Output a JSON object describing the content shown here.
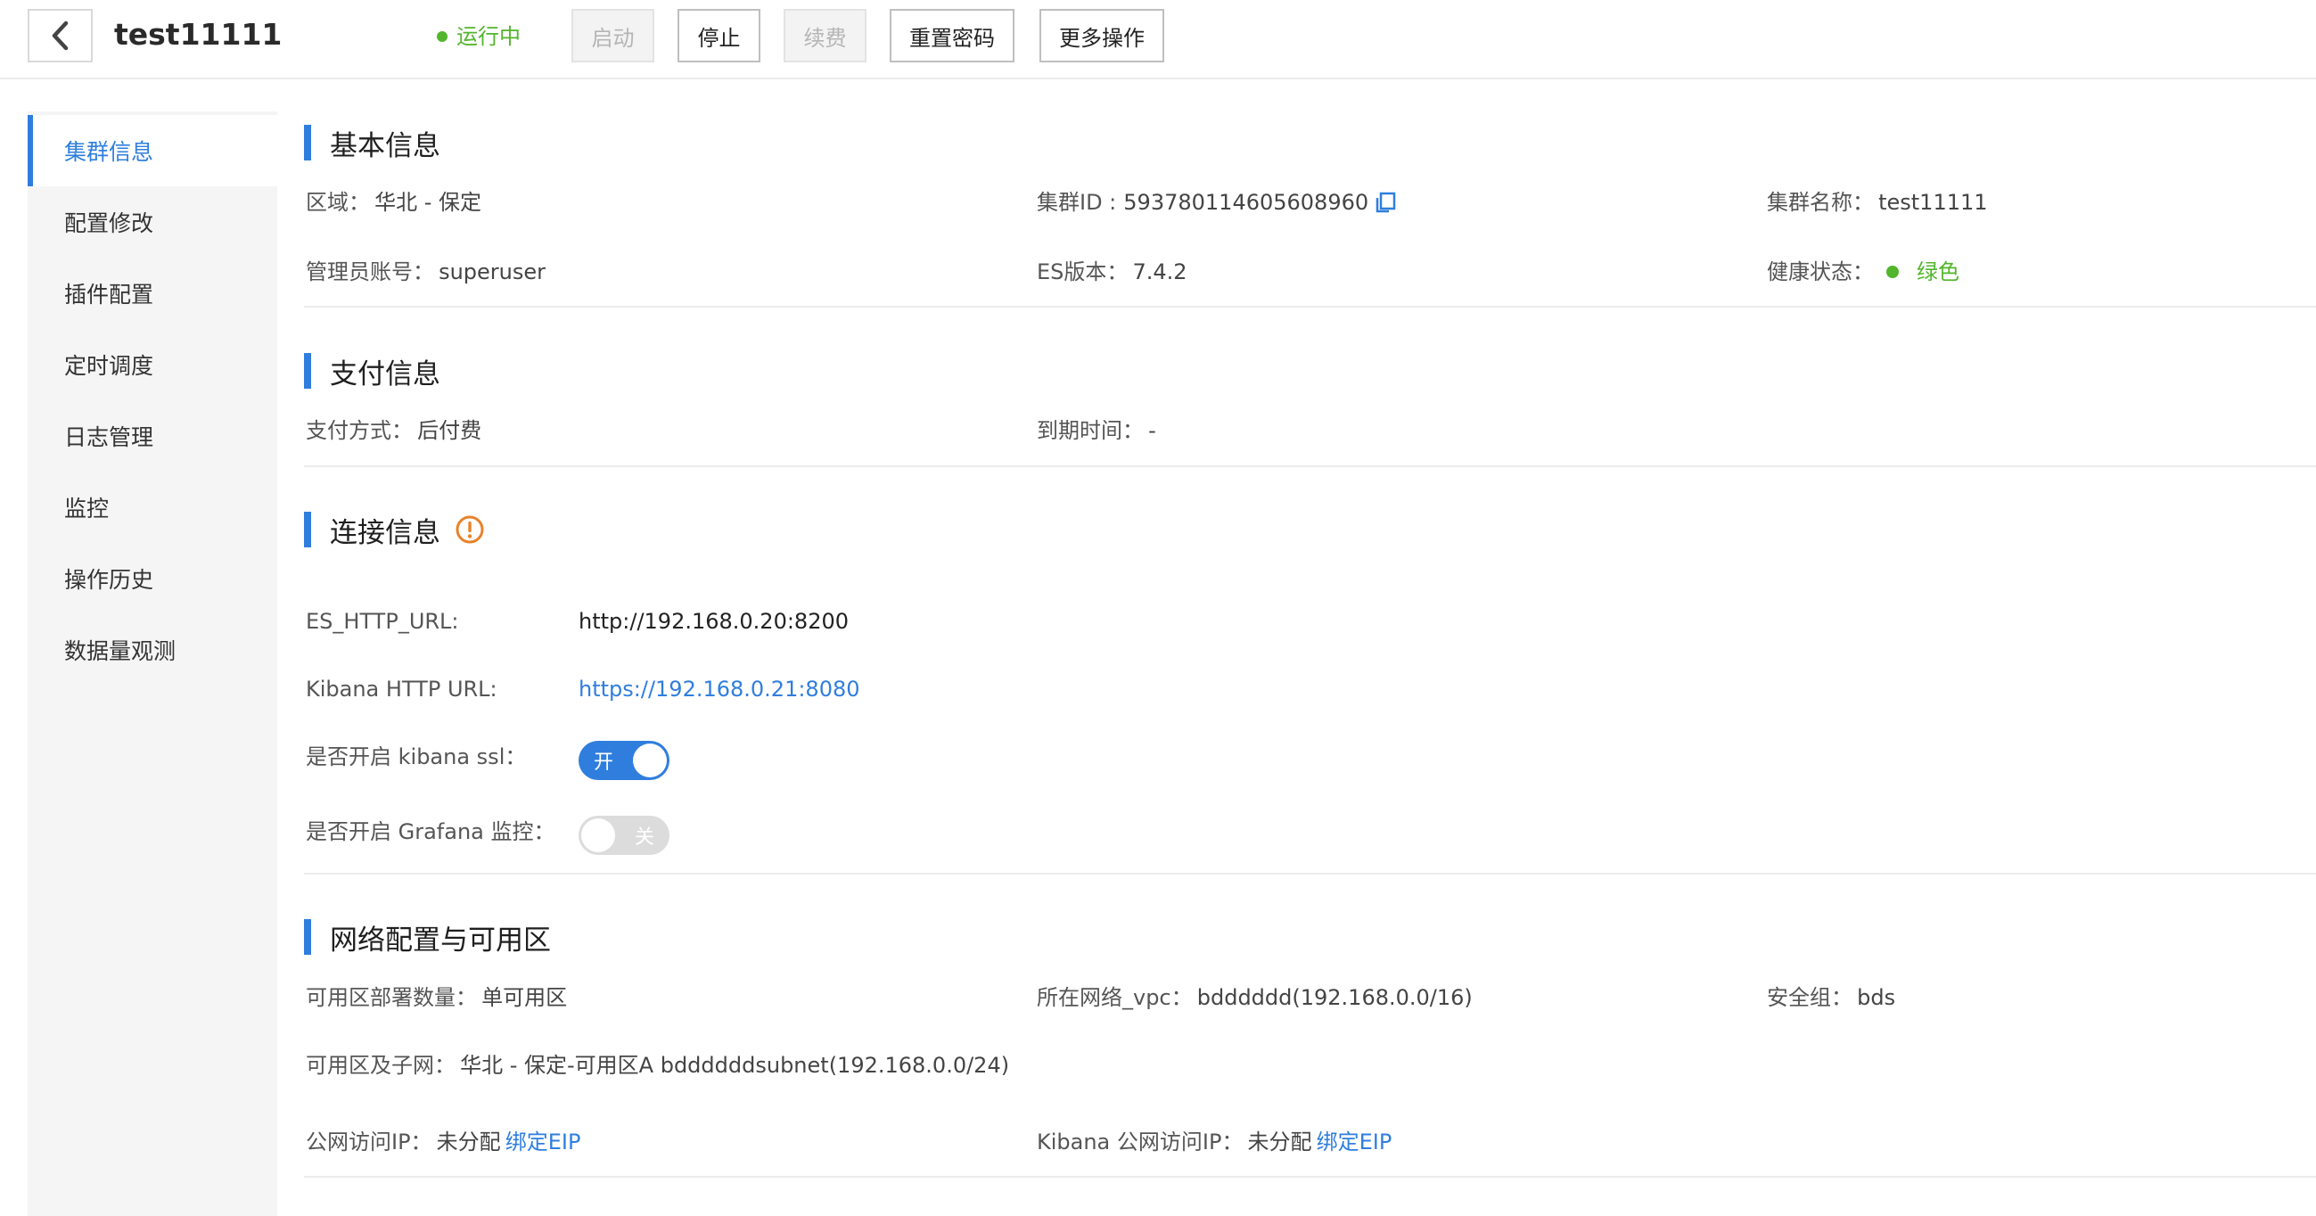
{
  "header": {
    "title": "test11111",
    "status": "运行中",
    "buttons": {
      "start": "启动",
      "stop": "停止",
      "renew": "续费",
      "reset_password": "重置密码",
      "more": "更多操作"
    }
  },
  "sidebar": {
    "items": [
      {
        "label": "集群信息",
        "active": true
      },
      {
        "label": "配置修改"
      },
      {
        "label": "插件配置"
      },
      {
        "label": "定时调度"
      },
      {
        "label": "日志管理"
      },
      {
        "label": "监控"
      },
      {
        "label": "操作历史"
      },
      {
        "label": "数据量观测"
      }
    ]
  },
  "basic_info": {
    "title": "基本信息",
    "region_label": "区域：",
    "region_value": "华北 - 保定",
    "cluster_id_label": "集群ID :",
    "cluster_id_value": "593780114605608960",
    "cluster_name_label": "集群名称：",
    "cluster_name_value": "test11111",
    "admin_label": "管理员账号：",
    "admin_value": "superuser",
    "es_version_label": "ES版本：",
    "es_version_value": "7.4.2",
    "health_label": "健康状态：",
    "health_value": "绿色"
  },
  "payment_info": {
    "title": "支付信息",
    "method_label": "支付方式：",
    "method_value": "后付费",
    "expiry_label": "到期时间：",
    "expiry_value": "-"
  },
  "connection_info": {
    "title": "连接信息",
    "es_url_label": "ES_HTTP_URL:",
    "es_url_value": "http://192.168.0.20:8200",
    "kibana_url_label": "Kibana HTTP URL:",
    "kibana_url_value": "https://192.168.0.21:8080",
    "kibana_ssl_label": "是否开启 kibana ssl：",
    "kibana_ssl_on": true,
    "kibana_ssl_text": "开",
    "grafana_label": "是否开启 Grafana 监控：",
    "grafana_on": false,
    "grafana_text": "关"
  },
  "network_info": {
    "title": "网络配置与可用区",
    "az_count_label": "可用区部署数量：",
    "az_count_value": "单可用区",
    "vpc_label": "所在网络_vpc：",
    "vpc_value": "bdddddd(192.168.0.0/16)",
    "security_group_label": "安全组：",
    "security_group_value": "bds",
    "az_subnet_label": "可用区及子网：",
    "az_subnet_value": "华北 - 保定-可用区A bddddddsubnet(192.168.0.0/24)",
    "public_ip_label": "公网访问IP：",
    "public_ip_value": "未分配",
    "public_ip_link": "绑定EIP",
    "kibana_public_ip_label": "Kibana 公网访问IP：",
    "kibana_public_ip_value": "未分配",
    "kibana_public_ip_link": "绑定EIP"
  },
  "colors": {
    "accent": "#2f7ede",
    "success": "#52b52c",
    "warning": "#e8822a"
  }
}
